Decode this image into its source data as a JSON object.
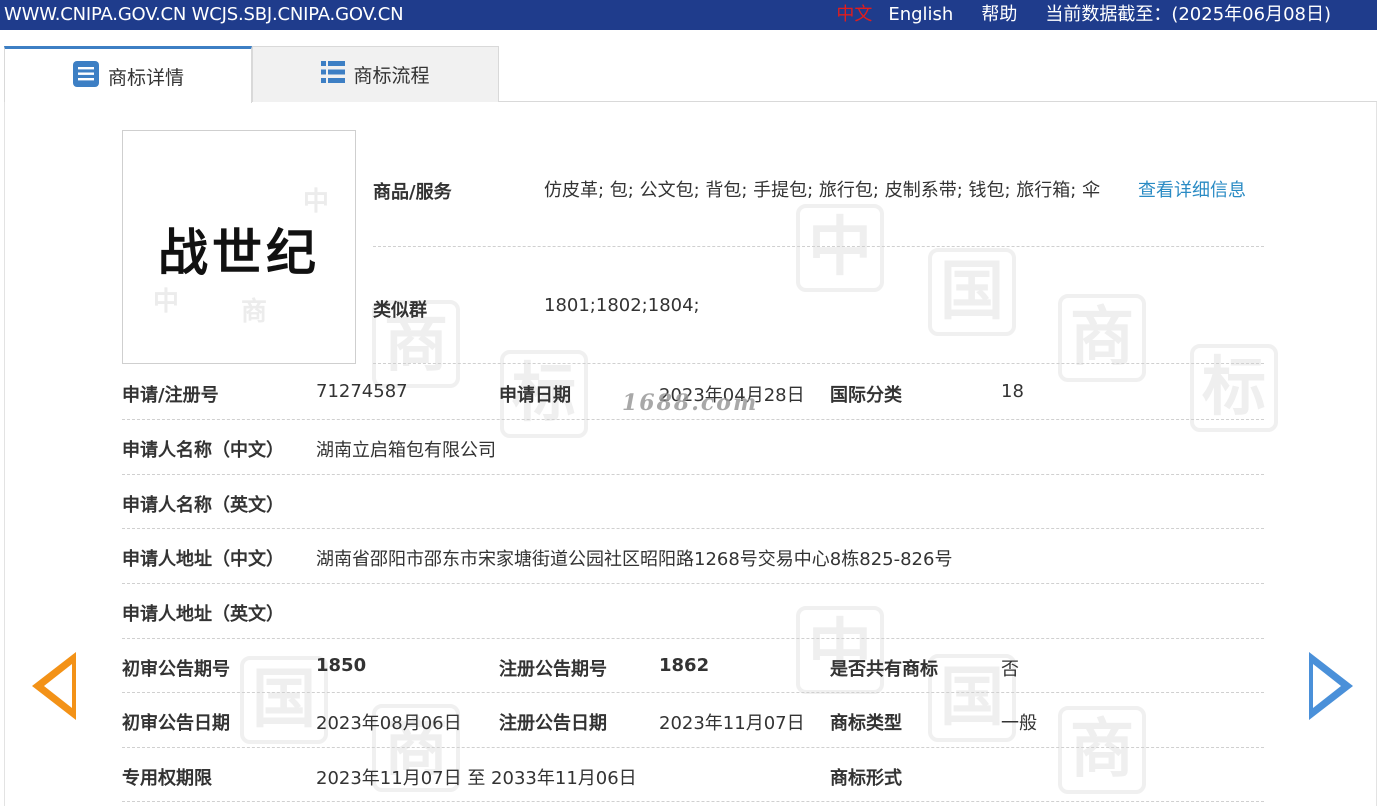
{
  "topbar": {
    "sites": "WWW.CNIPA.GOV.CN WCJS.SBJ.CNIPA.GOV.CN",
    "lang_zh": "中文",
    "lang_en": "English",
    "help": "帮助",
    "data_date": "当前数据截至：(2025年06月08日)"
  },
  "tabs": [
    {
      "label": "商标详情",
      "icon": "list-doc-icon",
      "active": true
    },
    {
      "label": "商标流程",
      "icon": "list-flow-icon",
      "active": false
    }
  ],
  "logo": {
    "text": "战世纪"
  },
  "watermark": "1688.com",
  "details": {
    "goods_label": "商品/服务",
    "goods_value": "仿皮革; 包; 公文包; 背包; 手提包; 旅行包; 皮制系带; 钱包; 旅行箱; 伞",
    "goods_link": "查看详细信息",
    "similar_label": "类似群",
    "similar_value": "1801;1802;1804;",
    "reg_no_label": "申请/注册号",
    "reg_no_value": "71274587",
    "apply_date_label": "申请日期",
    "apply_date_value": "2023年04月28日",
    "intl_class_label": "国际分类",
    "intl_class_value": "18",
    "applicant_cn_label": "申请人名称（中文）",
    "applicant_cn_value": "湖南立启箱包有限公司",
    "applicant_en_label": "申请人名称（英文）",
    "applicant_en_value": "",
    "address_cn_label": "申请人地址（中文）",
    "address_cn_value": "湖南省邵阳市邵东市宋家塘街道公园社区昭阳路1268号交易中心8栋825-826号",
    "address_en_label": "申请人地址（英文）",
    "address_en_value": "",
    "prelim_issue_label": "初审公告期号",
    "prelim_issue_value": "1850",
    "reg_issue_label": "注册公告期号",
    "reg_issue_value": "1862",
    "shared_label": "是否共有商标",
    "shared_value": "否",
    "prelim_date_label": "初审公告日期",
    "prelim_date_value": "2023年08月06日",
    "reg_date_label": "注册公告日期",
    "reg_date_value": "2023年11月07日",
    "mark_type_label": "商标类型",
    "mark_type_value": "一般",
    "term_label": "专用权期限",
    "term_value": "2023年11月07日 至 2033年11月06日",
    "mark_form_label": "商标形式",
    "mark_form_value": ""
  },
  "colors": {
    "topbar": "#1f3c8c",
    "link": "#2a8bc4",
    "arrow_prev": "#f39217",
    "arrow_next": "#4a90d9"
  }
}
